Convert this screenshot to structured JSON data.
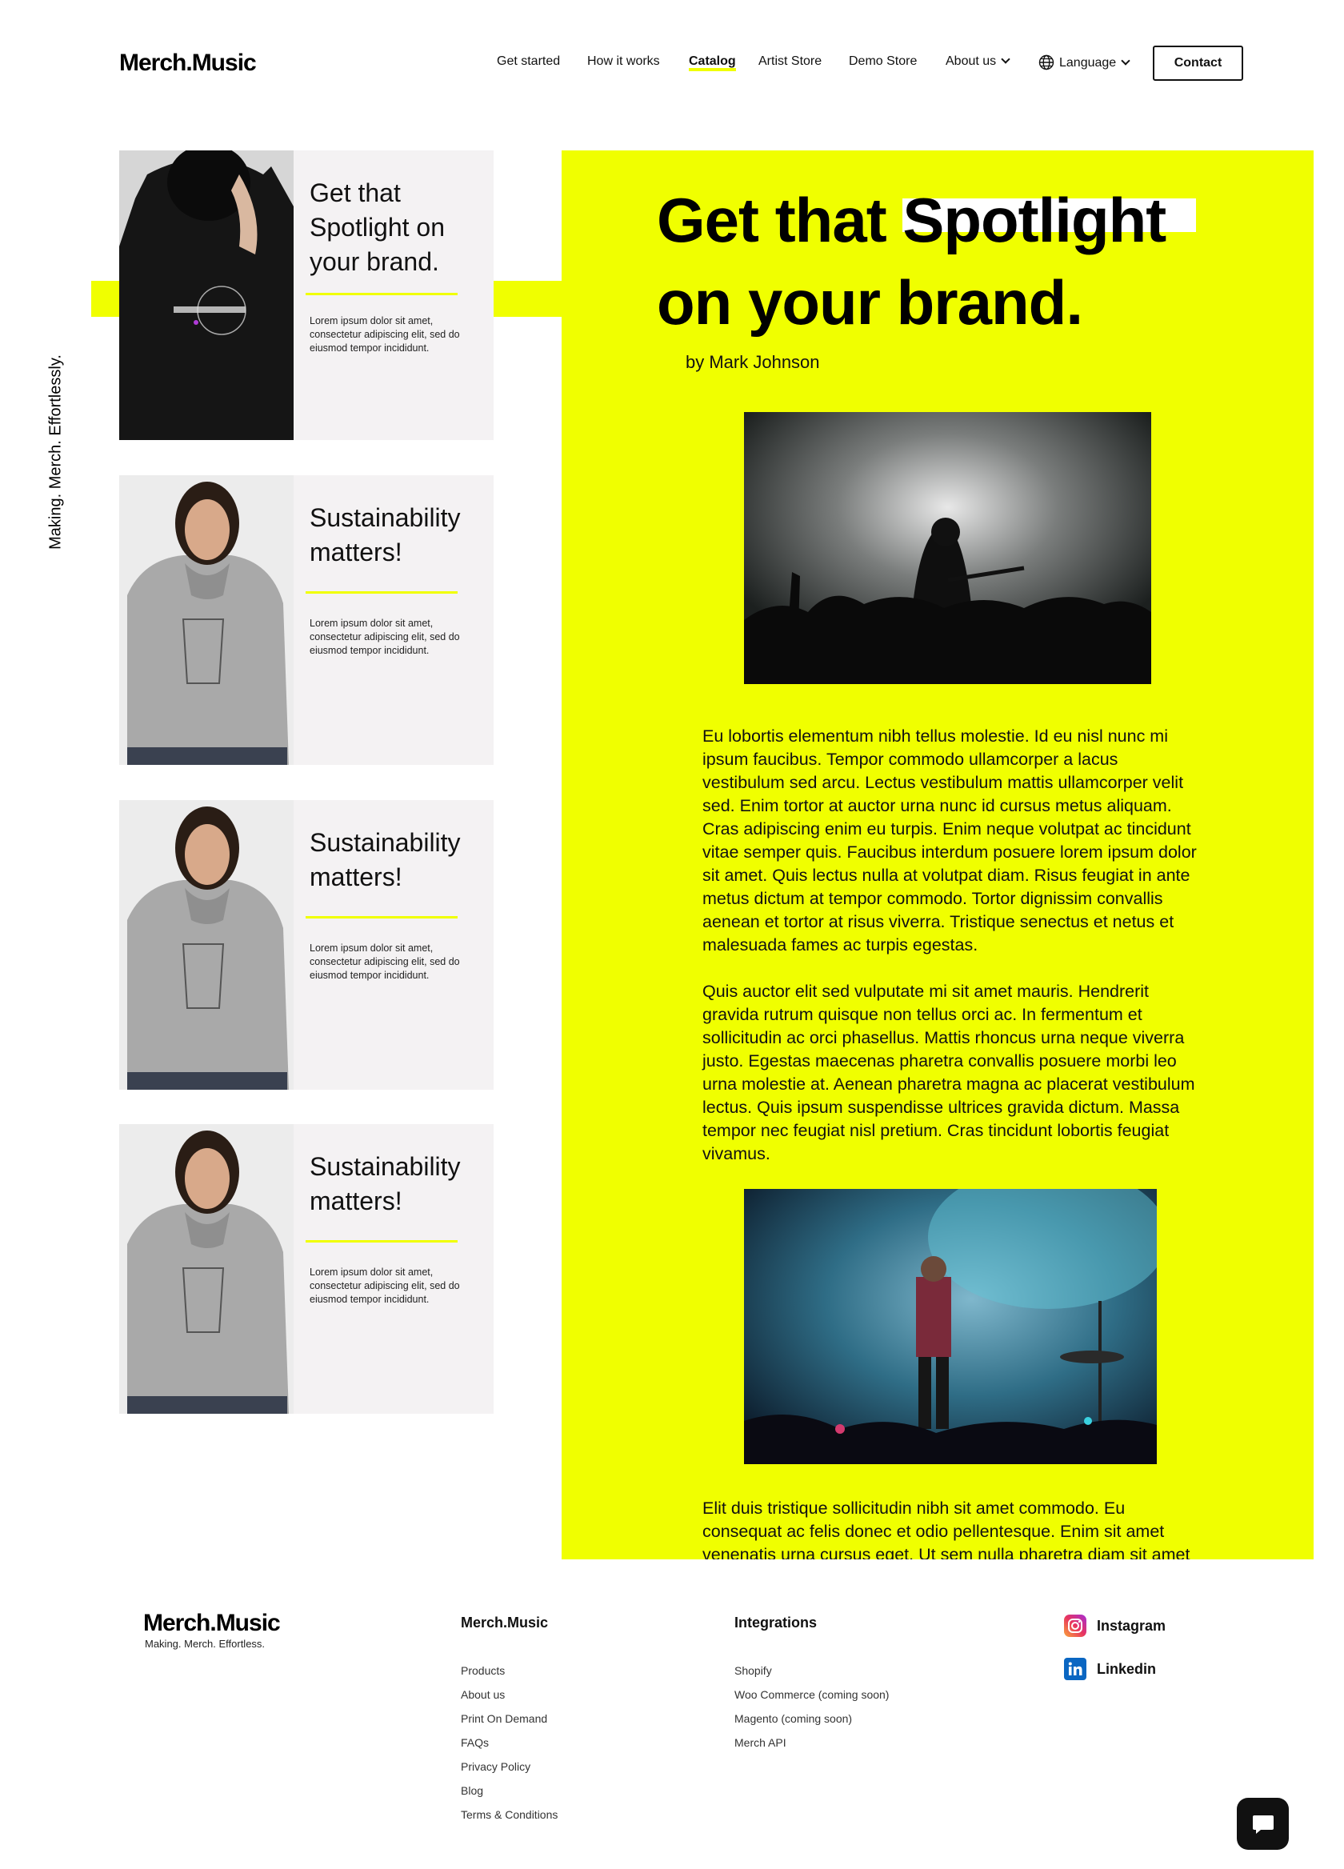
{
  "header": {
    "logo": "Merch.Music",
    "nav": [
      {
        "label": "Get started"
      },
      {
        "label": "How it works"
      },
      {
        "label": "Catalog",
        "active": true
      },
      {
        "label": "Artist Store"
      },
      {
        "label": "Demo Store"
      },
      {
        "label": "About us"
      },
      {
        "label": "Language"
      }
    ],
    "contact_label": "Contact"
  },
  "tagline": "Making. Merch. Effortlessly.",
  "cards": [
    {
      "title": "Get that Spotlight on your brand.",
      "text": "Lorem ipsum dolor sit amet, consectetur adipiscing elit, sed do eiusmod tempor incididunt."
    },
    {
      "title": "Sustainability matters!",
      "text": "Lorem ipsum dolor sit amet, consectetur adipiscing elit, sed do eiusmod tempor incididunt."
    },
    {
      "title": "Sustainability matters!",
      "text": "Lorem ipsum dolor sit amet, consectetur adipiscing elit, sed do eiusmod tempor incididunt."
    },
    {
      "title": "Sustainability matters!",
      "text": "Lorem ipsum dolor sit amet, consectetur adipiscing elit, sed do eiusmod tempor incididunt."
    }
  ],
  "article": {
    "title_part1": "Get that",
    "title_highlight": "Spotlight",
    "title_part2": "on your brand.",
    "byline": "by Mark Johnson",
    "paragraphs": [
      "Eu lobortis elementum nibh tellus molestie. Id eu nisl nunc mi ipsum faucibus. Tempor commodo ullamcorper a lacus vestibulum sed arcu. Lectus vestibulum mattis ullamcorper velit sed. Enim tortor at auctor urna nunc id cursus metus aliquam. Cras adipiscing enim eu turpis. Enim neque volutpat ac tincidunt vitae semper quis. Faucibus interdum posuere lorem ipsum dolor sit amet. Quis lectus nulla at volutpat diam. Risus feugiat in ante metus dictum at tempor commodo. Tortor dignissim convallis aenean et tortor at risus viverra. Tristique senectus et netus et malesuada fames ac turpis egestas.",
      "Quis auctor elit sed vulputate mi sit amet mauris. Hendrerit gravida rutrum quisque non tellus orci ac. In fermentum et sollicitudin ac orci phasellus. Mattis rhoncus urna neque viverra justo. Egestas maecenas pharetra convallis posuere morbi leo urna molestie at. Aenean pharetra magna ac placerat vestibulum lectus. Quis ipsum suspendisse ultrices gravida dictum. Massa tempor nec feugiat nisl pretium. Cras tincidunt lobortis feugiat vivamus.",
      "Elit duis tristique sollicitudin nibh sit amet commodo. Eu consequat ac felis donec et odio pellentesque. Enim sit amet venenatis urna cursus eget. Ut sem nulla pharetra diam sit amet"
    ]
  },
  "footer": {
    "logo": "Merch.Music",
    "tagline": "Making. Merch. Effortless.",
    "col1": {
      "heading": "Merch.Music",
      "links": [
        "Products",
        "About us",
        "Print On Demand",
        "FAQs",
        "Privacy Policy",
        "Blog",
        "Terms & Conditions"
      ]
    },
    "col2": {
      "heading": "Integrations",
      "links": [
        "Shopify",
        "Woo Commerce (coming soon)",
        "Magento (coming soon)",
        "Merch API"
      ]
    },
    "social": [
      {
        "label": "Instagram",
        "icon": "instagram-icon"
      },
      {
        "label": "Linkedin",
        "icon": "linkedin-icon"
      }
    ]
  },
  "colors": {
    "accent": "#f0ff00",
    "card_bg": "#f4f2f3",
    "text": "#111111"
  }
}
